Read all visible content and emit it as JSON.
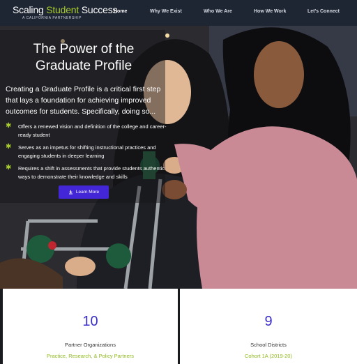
{
  "nav": {
    "logo_part1": "Scaling ",
    "logo_accent": "Student",
    "logo_part2": " Success",
    "logo_sub": "A CALIFORNIA PARTNERSHIP",
    "links": [
      "Home",
      "Why We Exist",
      "Who We Are",
      "How We Work",
      "Let's Connect"
    ],
    "active": "Home"
  },
  "hero": {
    "title_line1": "The Power of the",
    "title_line2": "Graduate Profile",
    "intro": "Creating a Graduate Profile is a critical first step that lays a foundation for achieving improved outcomes for students. Specifically, doing so...",
    "bullets": [
      "Offers a renewed vision and definition of the college and career-ready student",
      "Serves as an impetus for shifting instructional practices and engaging students in deeper learning",
      "Requires a shift in assessments that provide students authentic ways to demonstrate their knowledge and skills"
    ],
    "button_label": "Learn More",
    "button_icon": "download-icon"
  },
  "stats": [
    {
      "number": "10",
      "label": "Partner Organizations",
      "sub": "Practice, Research, & Policy Partners"
    },
    {
      "number": "9",
      "label": "School Districts",
      "sub": "Cohort 1A (2019-20)"
    }
  ],
  "colors": {
    "nav_bg": "#1e2533",
    "accent_green": "#a8cc2e",
    "button_purple": "#4326d6",
    "stat_number": "#3b2fc7"
  }
}
